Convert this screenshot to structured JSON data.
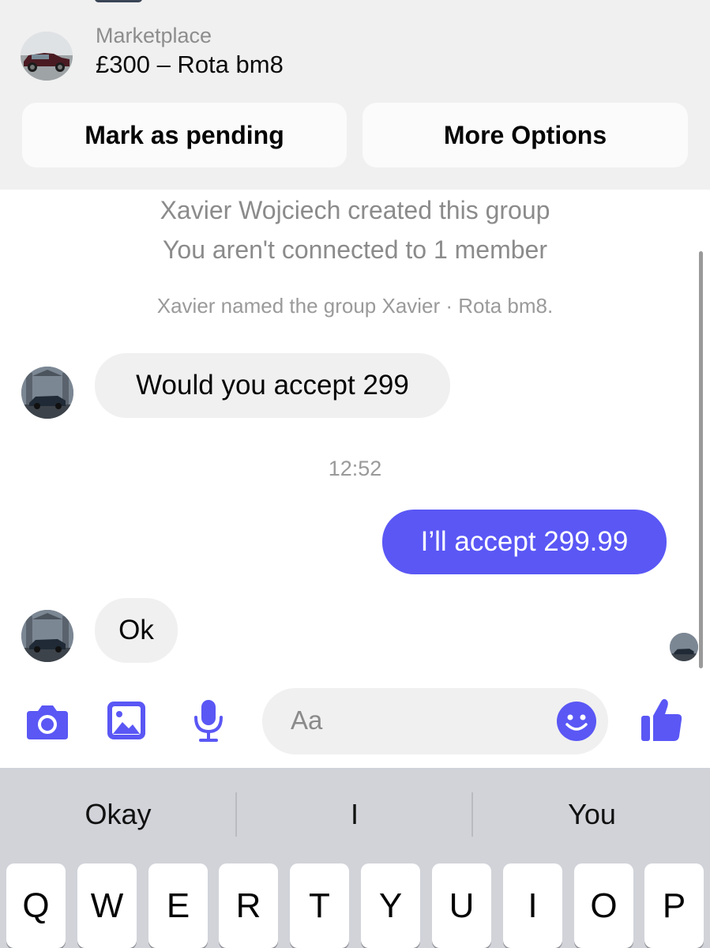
{
  "header": {
    "listing_kicker": "Marketplace",
    "listing_title": "£300 – Rota bm8",
    "mark_pending_label": "Mark as pending",
    "more_options_label": "More Options"
  },
  "thread": {
    "system_messages": [
      "Xavier Wojciech created this group",
      "You aren't connected to 1 member",
      "Xavier named the group Xavier · Rota bm8."
    ],
    "messages": [
      {
        "sender": "other",
        "text": "Would you accept 299"
      },
      {
        "sender": "me",
        "text": "I’ll accept 299.99"
      },
      {
        "sender": "other",
        "text": "Ok"
      }
    ],
    "timestamp": "12:52"
  },
  "composer": {
    "placeholder": "Aa",
    "icons": [
      "camera-icon",
      "image-icon",
      "microphone-icon",
      "emoji-icon",
      "thumbs-up-icon"
    ]
  },
  "keyboard": {
    "suggestions": [
      "Okay",
      "I",
      "You"
    ],
    "top_row": [
      "Q",
      "W",
      "E",
      "R",
      "T",
      "Y",
      "U",
      "I",
      "O",
      "P"
    ]
  },
  "colors": {
    "accent": "#5a57f5",
    "header_bg": "#f0f0f0",
    "incoming_bubble": "#f0f0f0",
    "keyboard_bg": "#d1d3d9"
  }
}
